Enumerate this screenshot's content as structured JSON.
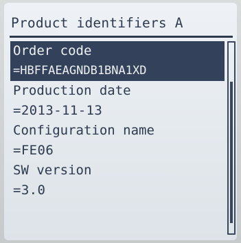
{
  "screen": {
    "title": "Product identifiers A"
  },
  "items": [
    {
      "label": "Order code",
      "value": "=HBFFAEAGNDB1BNA1XD"
    },
    {
      "label": "Production date",
      "value": "=2013-11-13"
    },
    {
      "label": "Configuration name",
      "value": "=FE06"
    },
    {
      "label": "SW version",
      "value": "=3.0"
    }
  ],
  "selected_index": 0,
  "scroll": {
    "thumb_fraction_start": 0.2,
    "thumb_fraction_size": 0.75
  }
}
